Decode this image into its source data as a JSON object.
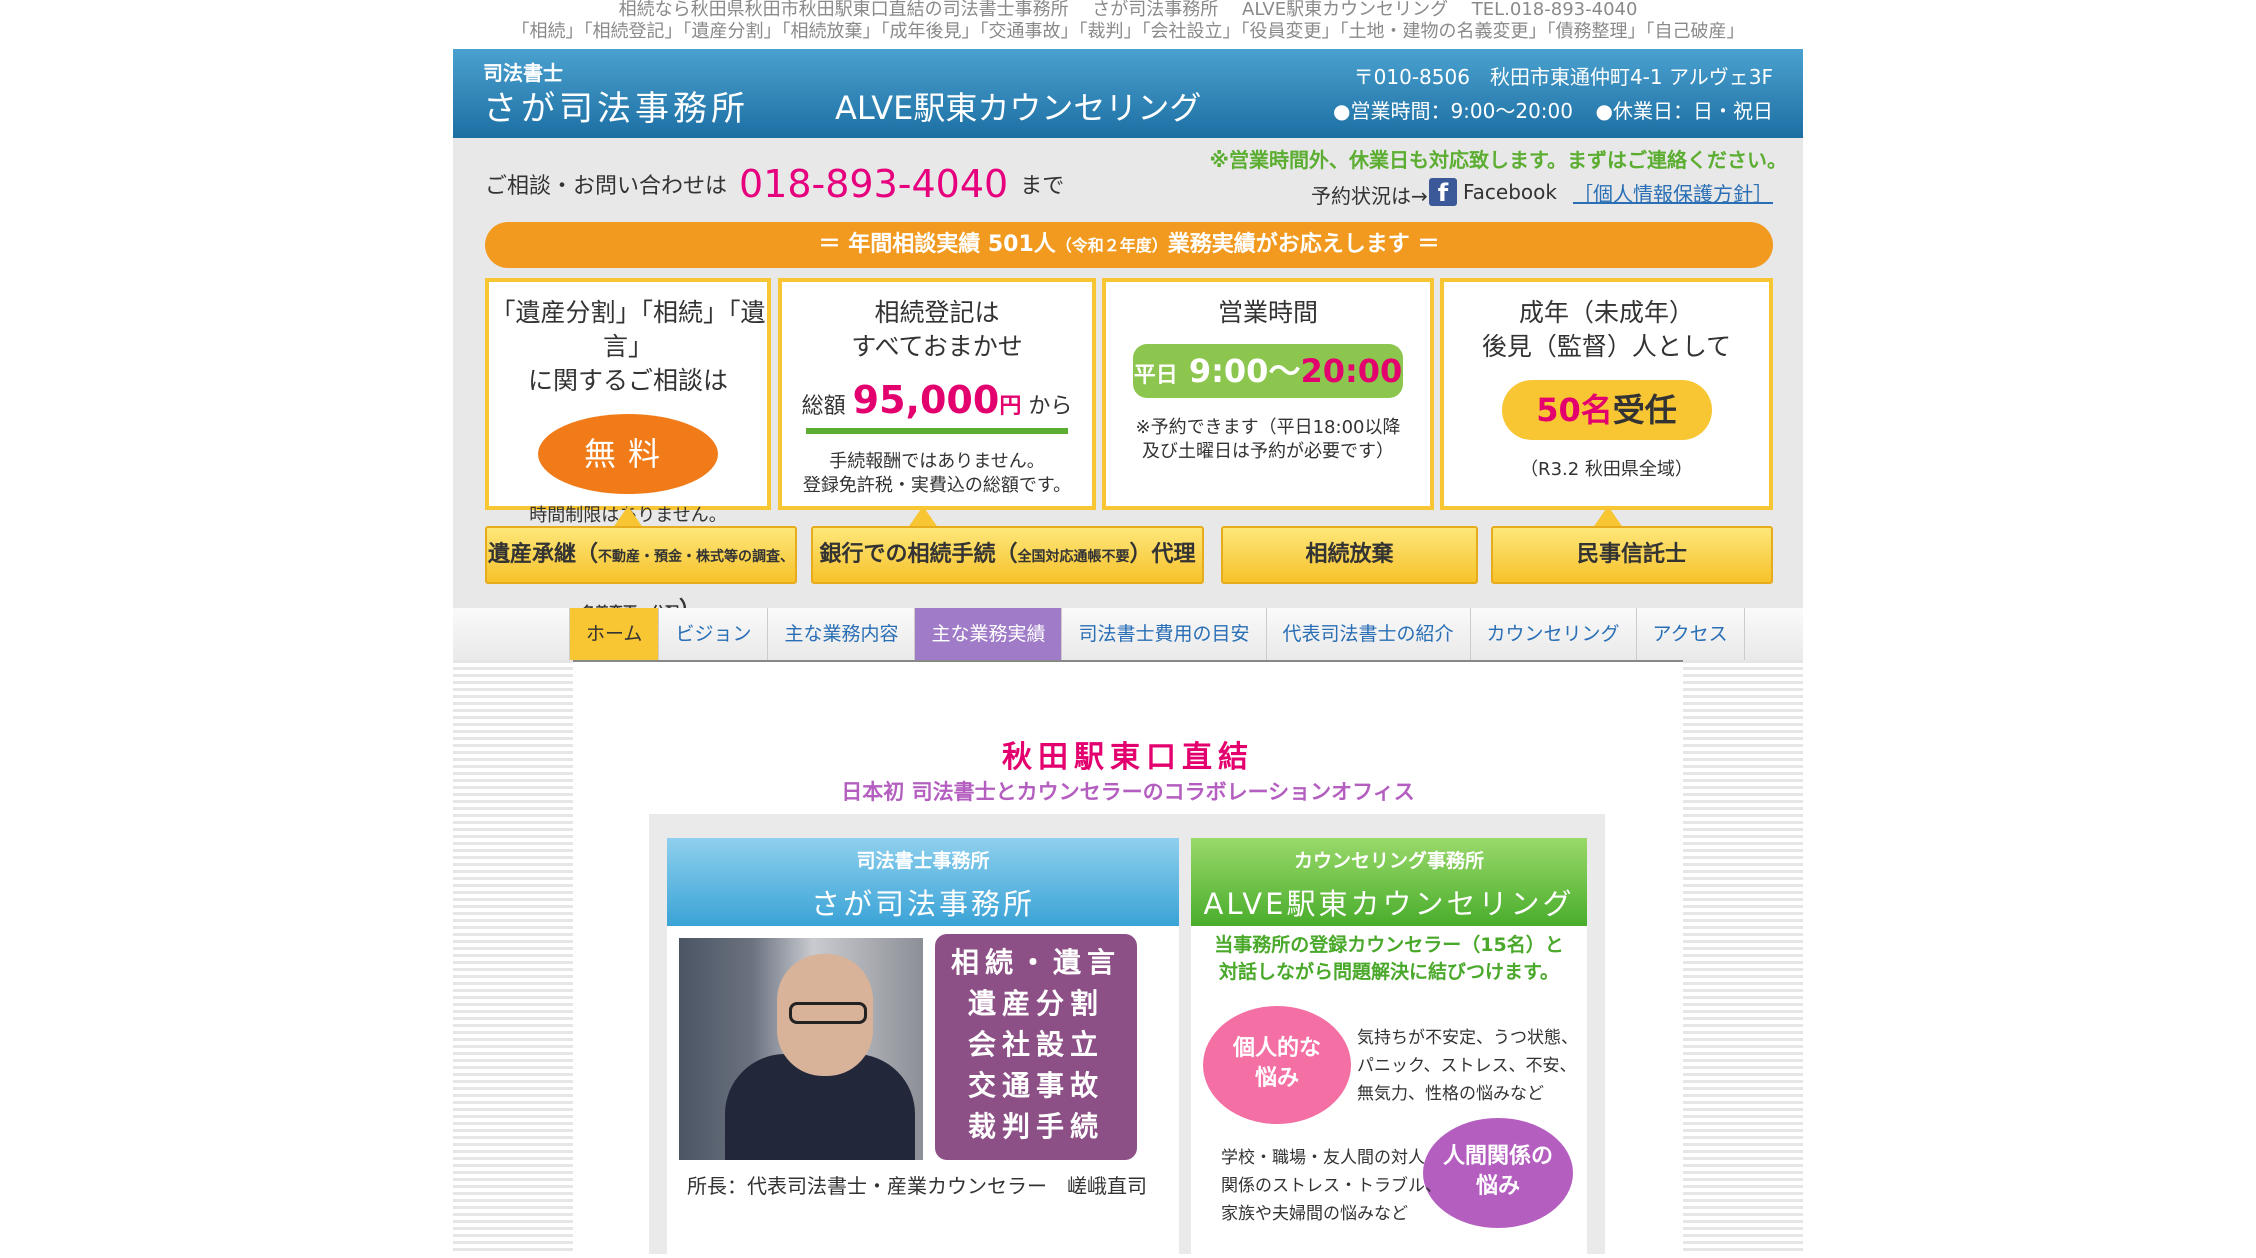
{
  "tagline": {
    "line1": "相続なら秋田県秋田市秋田駅東口直結の司法書士事務所　 さが司法事務所　 ALVE駅東カウンセリング　 TEL.018-893-4040",
    "line2": "「相続」「相続登記」「遺産分割」「相続放棄」「成年後見」「交通事故」「裁判」「会社設立」「役員変更」「土地・建物の名義変更」「債務整理」「自己破産」"
  },
  "banner": {
    "small": "司法書士",
    "office": "さが司法事務所",
    "counseling": "ALVE駅東カウンセリング",
    "address": "〒010-8506　秋田市東通仲町4-1 アルヴェ3F",
    "hours": "●営業時間：9:00～20:00",
    "closed": "●休業日：日・祝日"
  },
  "contact": {
    "prefix": "ご相談・お問い合わせは",
    "tel": "018-893-4040",
    "suffix": "まで"
  },
  "notice": "※営業時間外、休業日も対応致します。まずはご連絡ください。",
  "yoyaku": "予約状況は→",
  "facebook": "Facebook",
  "privacy": "［個人情報保護方針］",
  "stats": {
    "text": "＝ 年間相談実績 501人",
    "small": "（令和２年度）",
    "after": "業務実績がお応えします ＝"
  },
  "cards": {
    "c1": {
      "t1": "「遺産分割」「相続」「遺言」",
      "t2": "に関するご相談は",
      "pill": "無料",
      "note": "時間制限はありません。"
    },
    "c2": {
      "t1": "相続登記は",
      "t2": "すべておまかせ",
      "pre": "総額",
      "price": "95,000",
      "unit": "円",
      "post": "から",
      "note1": "手続報酬ではありません。",
      "note2": "登録免許税・実費込の総額です。"
    },
    "c3": {
      "t1": "営業時間",
      "day": "平日",
      "from": "9:00～",
      "to": "20:00",
      "note1": "※予約できます（平日18:00以降",
      "note2": "及び土曜日は予約が必要です）"
    },
    "c4": {
      "t1": "成年（未成年）",
      "t2": "後見（監督）人として",
      "num": "50名",
      "accepted": "受任",
      "note": "（R3.2 秋田県全域）"
    }
  },
  "buttons": {
    "b1": {
      "main": "遺産承継（",
      "small": "不動産・預金・株式等の調査、名義変更、分配",
      "end": "）"
    },
    "b2": {
      "main": "銀行での相続手続（",
      "small": "全国対応通帳不要",
      "end": "）代理"
    },
    "b3": "相続放棄",
    "b4": "民事信託士"
  },
  "nav": [
    "ホーム",
    "ビジョン",
    "主な業務内容",
    "主な業務実績",
    "司法書士費用の目安",
    "代表司法書士の紹介",
    "カウンセリング",
    "アクセス"
  ],
  "content": {
    "head1": "秋田駅東口直結",
    "head2": "日本初 司法書士とカウンセラーのコラボレーションオフィス",
    "left_small": "司法書士事務所",
    "left_big": "さが司法事務所",
    "services": [
      "相続・遺言",
      "遺産分割",
      "会社設立",
      "交通事故",
      "裁判手続"
    ],
    "caption": "所長：代表司法書士・産業カウンセラー　嵯峨直司",
    "right_small": "カウンセリング事務所",
    "right_big": "ALVE駅東カウンセリング",
    "desc1": "当事務所の登録カウンセラー（15名）と",
    "desc2": "対話しながら問題解決に結びつけます。",
    "circle1a": "個人的な",
    "circle1b": "悩み",
    "text1a": "気持ちが不安定、うつ状態、",
    "text1b": "パニック、ストレス、不安、",
    "text1c": "無気力、性格の悩みなど",
    "circle2a": "人間関係の",
    "circle2b": "悩み",
    "text2a": "学校・職場・友人間の対人",
    "text2b": "関係のストレス・トラブル、",
    "text2c": "家族や夫婦間の悩みなど"
  }
}
